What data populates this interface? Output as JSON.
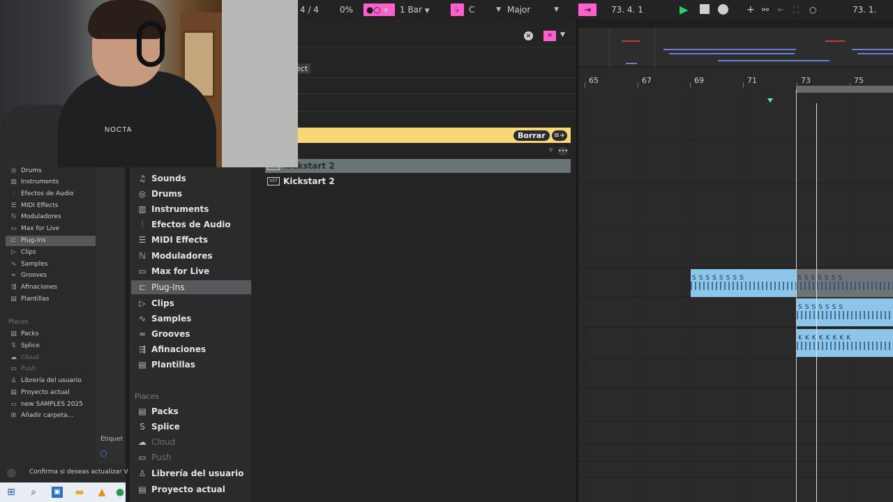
{
  "transport": {
    "time_signature": "4 / 4",
    "cpu": "0%",
    "quantize": "1 Bar",
    "key": "C",
    "scale": "Major",
    "position": "73.   4.   1",
    "position_right": "73.   1."
  },
  "webcam": {
    "shirt_text": "NOCTA"
  },
  "browser_small": {
    "items": [
      {
        "label": "Drums",
        "icon": "drum-icon"
      },
      {
        "label": "Instruments",
        "icon": "keyboard-icon"
      },
      {
        "label": "Efectos de Audio",
        "icon": "audio-effect-icon"
      },
      {
        "label": "MIDI Effects",
        "icon": "midi-effect-icon"
      },
      {
        "label": "Moduladores",
        "icon": "modulator-icon"
      },
      {
        "label": "Max for Live",
        "icon": "max-icon"
      },
      {
        "label": "Plug-Ins",
        "icon": "plugin-icon"
      },
      {
        "label": "Clips",
        "icon": "clip-icon"
      },
      {
        "label": "Samples",
        "icon": "sample-icon"
      },
      {
        "label": "Grooves",
        "icon": "groove-icon"
      },
      {
        "label": "Afinaciones",
        "icon": "tuning-icon"
      },
      {
        "label": "Plantillas",
        "icon": "template-icon"
      }
    ],
    "places_heading": "Places",
    "places": [
      {
        "label": "Packs"
      },
      {
        "label": "Splice"
      },
      {
        "label": "Cloud"
      },
      {
        "label": "Push"
      },
      {
        "label": "Librería del usuario"
      },
      {
        "label": "Proyecto actual"
      },
      {
        "label": "new SAMPLES 2025"
      },
      {
        "label": "Añadir carpeta..."
      }
    ],
    "tags_label": "Etiquet"
  },
  "browser_big": {
    "items": [
      {
        "label": "Sounds"
      },
      {
        "label": "Drums"
      },
      {
        "label": "Instruments"
      },
      {
        "label": "Efectos de Audio"
      },
      {
        "label": "MIDI Effects"
      },
      {
        "label": "Moduladores"
      },
      {
        "label": "Max for Live"
      },
      {
        "label": "Plug-Ins"
      },
      {
        "label": "Clips"
      },
      {
        "label": "Samples"
      },
      {
        "label": "Grooves"
      },
      {
        "label": "Afinaciones"
      },
      {
        "label": "Plantillas"
      }
    ],
    "places_heading": "Places",
    "places": [
      {
        "label": "Packs"
      },
      {
        "label": "Splice"
      },
      {
        "label": "Cloud"
      },
      {
        "label": "Push"
      },
      {
        "label": "Librería del usuario"
      },
      {
        "label": "Proyecto actual"
      }
    ]
  },
  "content": {
    "tooltip": "ect",
    "clear_label": "Borrar",
    "results": [
      {
        "label": "Kickstart 2",
        "selected": true
      },
      {
        "label": "Kickstart 2",
        "selected": false
      }
    ]
  },
  "arrangement": {
    "bars": [
      "65",
      "67",
      "69",
      "71",
      "73",
      "75"
    ]
  },
  "status": {
    "message": "Confirma si deseas actualizar V"
  },
  "colors": {
    "accent_pink": "#ff5fcf",
    "filter_yellow": "#f6d877",
    "clip_blue": "#8ec5ea",
    "play_green": "#27d16b"
  }
}
